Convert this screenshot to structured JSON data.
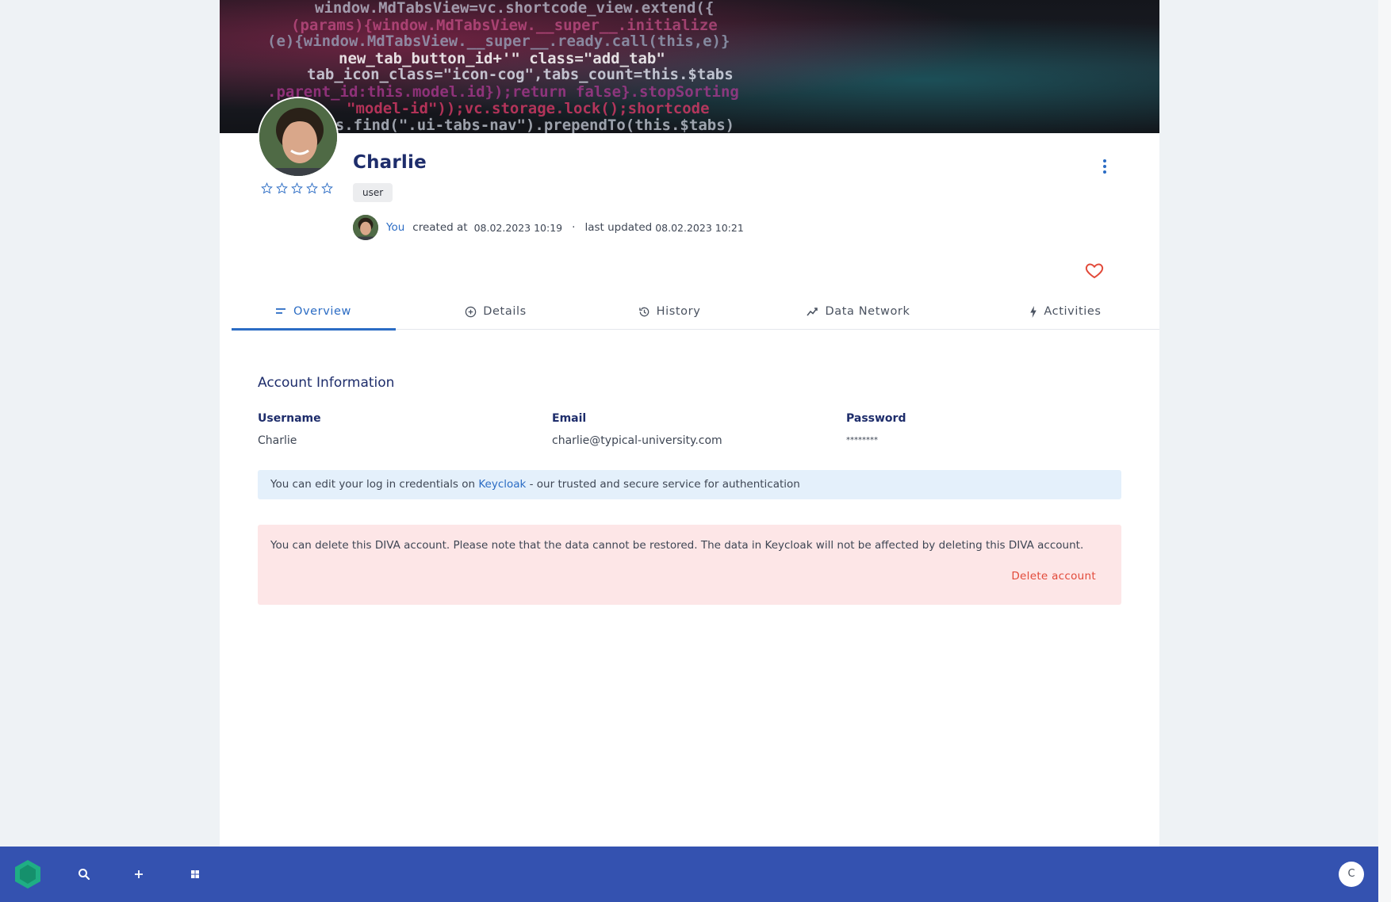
{
  "profile": {
    "name": "Charlie",
    "role": "user",
    "rating_stars": 5,
    "rating_value": 0,
    "creator": "You",
    "created_label": "created at",
    "created_at": "08.02.2023 10:19",
    "separator": "·",
    "updated_label": "last updated",
    "updated_at": "08.02.2023 10:21"
  },
  "tabs": [
    {
      "label": "Overview",
      "icon": "lines-icon",
      "active": true
    },
    {
      "label": "Details",
      "icon": "plus-circle-icon",
      "active": false
    },
    {
      "label": "History",
      "icon": "history-icon",
      "active": false
    },
    {
      "label": "Data Network",
      "icon": "trend-icon",
      "active": false
    },
    {
      "label": "Activities",
      "icon": "bolt-icon",
      "active": false
    }
  ],
  "account": {
    "title": "Account Information",
    "username_label": "Username",
    "username_value": "Charlie",
    "email_label": "Email",
    "email_value": "charlie@typical-university.com",
    "password_label": "Password",
    "password_value": "********"
  },
  "info": {
    "text_before": "You can edit your log in credentials on ",
    "link": "Keycloak",
    "text_after": " - our trusted and secure service for authentication"
  },
  "danger": {
    "text": "You can delete this DIVA account. Please note that the data cannot be restored. The data in Keycloak will not be affected by deleting this DIVA account.",
    "button": "Delete account"
  },
  "bottombar": {
    "user_initial": "C",
    "icons": [
      "search-icon",
      "plus-icon",
      "grid-icon"
    ]
  },
  "colors": {
    "accent": "#2b6cc4",
    "navy": "#1e2d6b",
    "bottombar": "#3452b0",
    "danger": "#e24a3a",
    "logo": "#1fae84"
  }
}
